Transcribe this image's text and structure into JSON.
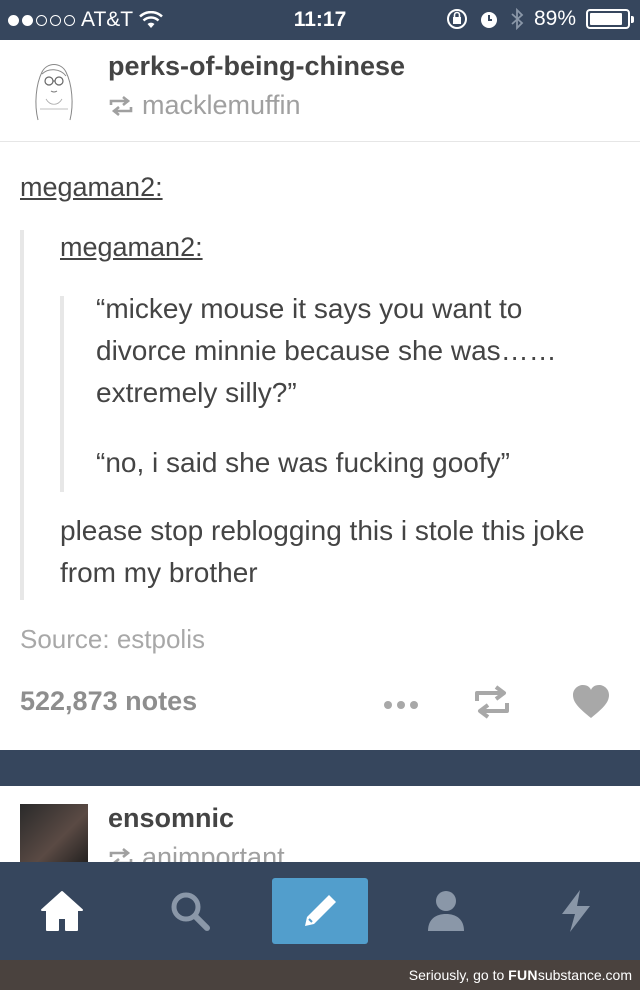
{
  "status_bar": {
    "carrier": "AT&T",
    "time": "11:17",
    "battery_percent": "89%",
    "battery_level": 0.89,
    "signal_bars_filled": 2,
    "signal_bars_total": 5
  },
  "post": {
    "blog_name": "perks-of-being-chinese",
    "reblogged_from": "macklemuffin",
    "reblog_chain": [
      {
        "user": "megaman2:"
      },
      {
        "user": "megaman2:"
      }
    ],
    "quote_lines": [
      "“mickey mouse it says you want to divorce minnie because she was…… extremely silly?”",
      "“no, i said she was fucking goofy”"
    ],
    "reply": "please stop reblogging this i stole this joke from my brother",
    "source": "Source: estpolis",
    "notes": "522,873 notes"
  },
  "next_post": {
    "blog_name": "ensomnic",
    "reblogged_from": "animportant"
  },
  "tabs": [
    "home-icon",
    "search-icon",
    "compose-icon",
    "account-icon",
    "activity-icon"
  ],
  "watermark": {
    "prefix": "Seriously, go to ",
    "brand_bold": "FUN",
    "brand_rest": "substance.com"
  },
  "colors": {
    "header_navy": "#36465d",
    "compose_blue": "#529ecc",
    "text_dark": "#444444",
    "text_grey": "#a8a8a8"
  }
}
